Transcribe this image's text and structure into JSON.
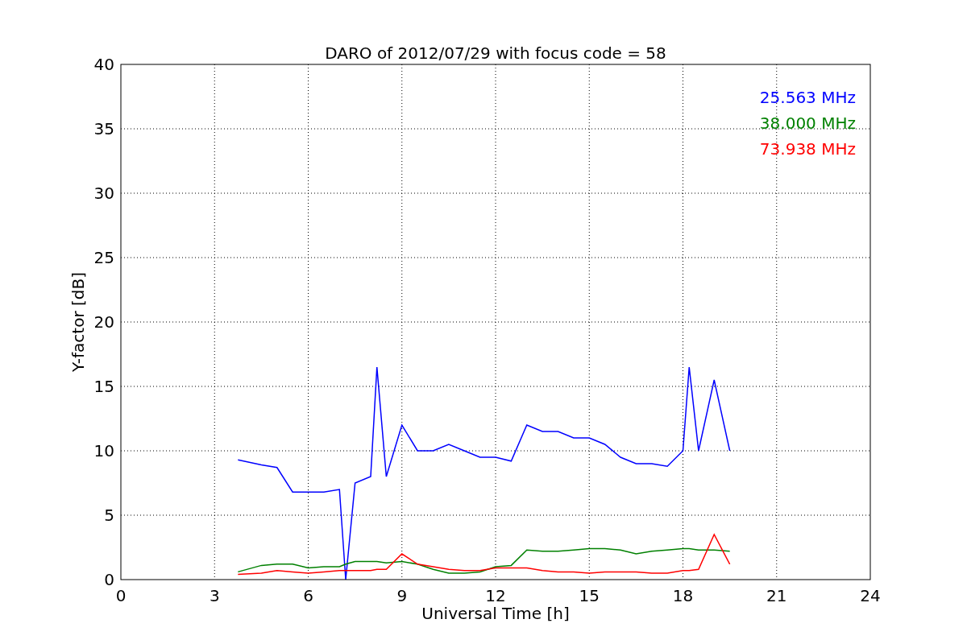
{
  "chart_data": {
    "type": "line",
    "title": "DARO of 2012/07/29 with focus code = 58",
    "xlabel": "Universal Time [h]",
    "ylabel": "Y-factor [dB]",
    "x": [
      3.75,
      4.5,
      5,
      5.5,
      6,
      6.5,
      7,
      7.2,
      7.5,
      8,
      8.2,
      8.5,
      9,
      9.5,
      10,
      10.5,
      11,
      11.5,
      12,
      12.5,
      13,
      13.5,
      14,
      14.5,
      15,
      15.5,
      16,
      16.5,
      17,
      17.5,
      18,
      18.2,
      18.5,
      19,
      19.5
    ],
    "series": [
      {
        "name": "25.563 MHz",
        "color": "#0000ff",
        "values": [
          9.3,
          8.9,
          8.7,
          6.8,
          6.8,
          6.8,
          7.0,
          0,
          7.5,
          8,
          16.5,
          8,
          12,
          10,
          10,
          10.5,
          10,
          9.5,
          9.5,
          9.2,
          12,
          11.5,
          11.5,
          11,
          11,
          10.5,
          9.5,
          9,
          9,
          8.8,
          10,
          16.5,
          10,
          15.5,
          10
        ]
      },
      {
        "name": "38.000 MHz",
        "color": "#008000",
        "values": [
          0.6,
          1.1,
          1.2,
          1.2,
          0.9,
          1.0,
          1.0,
          1.2,
          1.4,
          1.4,
          1.4,
          1.3,
          1.4,
          1.2,
          0.8,
          0.5,
          0.5,
          0.6,
          1.0,
          1.1,
          2.3,
          2.2,
          2.2,
          2.3,
          2.4,
          2.4,
          2.3,
          2.0,
          2.2,
          2.3,
          2.4,
          2.4,
          2.3,
          2.3,
          2.2
        ]
      },
      {
        "name": "73.938 MHz",
        "color": "#ff0000",
        "values": [
          0.4,
          0.5,
          0.7,
          0.6,
          0.5,
          0.6,
          0.7,
          0.7,
          0.7,
          0.7,
          0.8,
          0.8,
          2.0,
          1.2,
          1.0,
          0.8,
          0.7,
          0.7,
          0.9,
          0.9,
          0.9,
          0.7,
          0.6,
          0.6,
          0.5,
          0.6,
          0.6,
          0.6,
          0.5,
          0.5,
          0.7,
          0.7,
          0.8,
          3.5,
          1.2
        ]
      }
    ],
    "grid": true,
    "xlim": [
      0,
      24
    ],
    "ylim": [
      0,
      40
    ],
    "xticks": [
      0,
      3,
      6,
      9,
      12,
      15,
      18,
      21,
      24
    ],
    "yticks": [
      0,
      5,
      10,
      15,
      20,
      25,
      30,
      35,
      40
    ]
  }
}
